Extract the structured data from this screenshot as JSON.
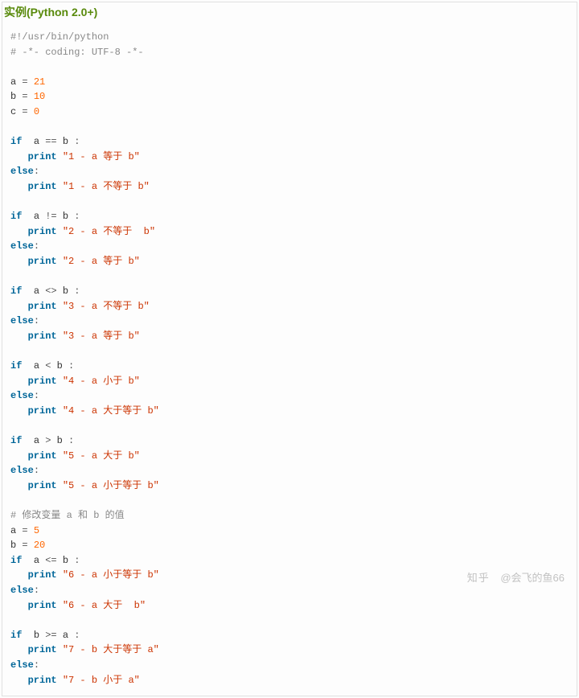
{
  "header": {
    "title": "实例(Python 2.0+)"
  },
  "code": {
    "shebang": "#!/usr/bin/python",
    "coding": "# -*- coding: UTF-8 -*-",
    "assign": {
      "a_var": "a",
      "a_eq": "=",
      "a_val": "21",
      "b_var": "b",
      "b_eq": "=",
      "b_val": "10",
      "c_var": "c",
      "c_eq": "=",
      "c_val": "0"
    },
    "blk1": {
      "if_kw": "if",
      "lhs": "a",
      "op": "==",
      "rhs": "b",
      "colon": ":",
      "print1": "print",
      "str1": "\"1 - a 等于 b\"",
      "else_kw": "else",
      "else_colon": ":",
      "print2": "print",
      "str2": "\"1 - a 不等于 b\""
    },
    "blk2": {
      "if_kw": "if",
      "lhs": "a",
      "op": "!=",
      "rhs": "b",
      "colon": ":",
      "print1": "print",
      "str1": "\"2 - a 不等于  b\"",
      "else_kw": "else",
      "else_colon": ":",
      "print2": "print",
      "str2": "\"2 - a 等于 b\""
    },
    "blk3": {
      "if_kw": "if",
      "lhs": "a",
      "op": "<>",
      "rhs": "b",
      "colon": ":",
      "print1": "print",
      "str1": "\"3 - a 不等于 b\"",
      "else_kw": "else",
      "else_colon": ":",
      "print2": "print",
      "str2": "\"3 - a 等于 b\""
    },
    "blk4": {
      "if_kw": "if",
      "lhs": "a",
      "op": "<",
      "rhs": "b",
      "colon": ":",
      "print1": "print",
      "str1": "\"4 - a 小于 b\"",
      "else_kw": "else",
      "else_colon": ":",
      "print2": "print",
      "str2": "\"4 - a 大于等于 b\""
    },
    "blk5": {
      "if_kw": "if",
      "lhs": "a",
      "op": ">",
      "rhs": "b",
      "colon": ":",
      "print1": "print",
      "str1": "\"5 - a 大于 b\"",
      "else_kw": "else",
      "else_colon": ":",
      "print2": "print",
      "str2": "\"5 - a 小于等于 b\""
    },
    "modcomment": "# 修改变量 a 和 b 的值",
    "reassign": {
      "a_var": "a",
      "a_eq": "=",
      "a_val": "5",
      "b_var": "b",
      "b_eq": "=",
      "b_val": "20"
    },
    "blk6": {
      "if_kw": "if",
      "lhs": "a",
      "op": "<=",
      "rhs": "b",
      "colon": ":",
      "print1": "print",
      "str1": "\"6 - a 小于等于 b\"",
      "else_kw": "else",
      "else_colon": ":",
      "print2": "print",
      "str2": "\"6 - a 大于  b\""
    },
    "blk7": {
      "if_kw": "if",
      "lhs": "b",
      "op": ">=",
      "rhs": "a",
      "colon": ":",
      "print1": "print",
      "str1": "\"7 - b 大于等于 a\"",
      "else_kw": "else",
      "else_colon": ":",
      "print2": "print",
      "str2": "\"7 - b 小于 a\""
    }
  },
  "watermark": {
    "brand": "知乎",
    "author": "@会飞的鱼66"
  }
}
